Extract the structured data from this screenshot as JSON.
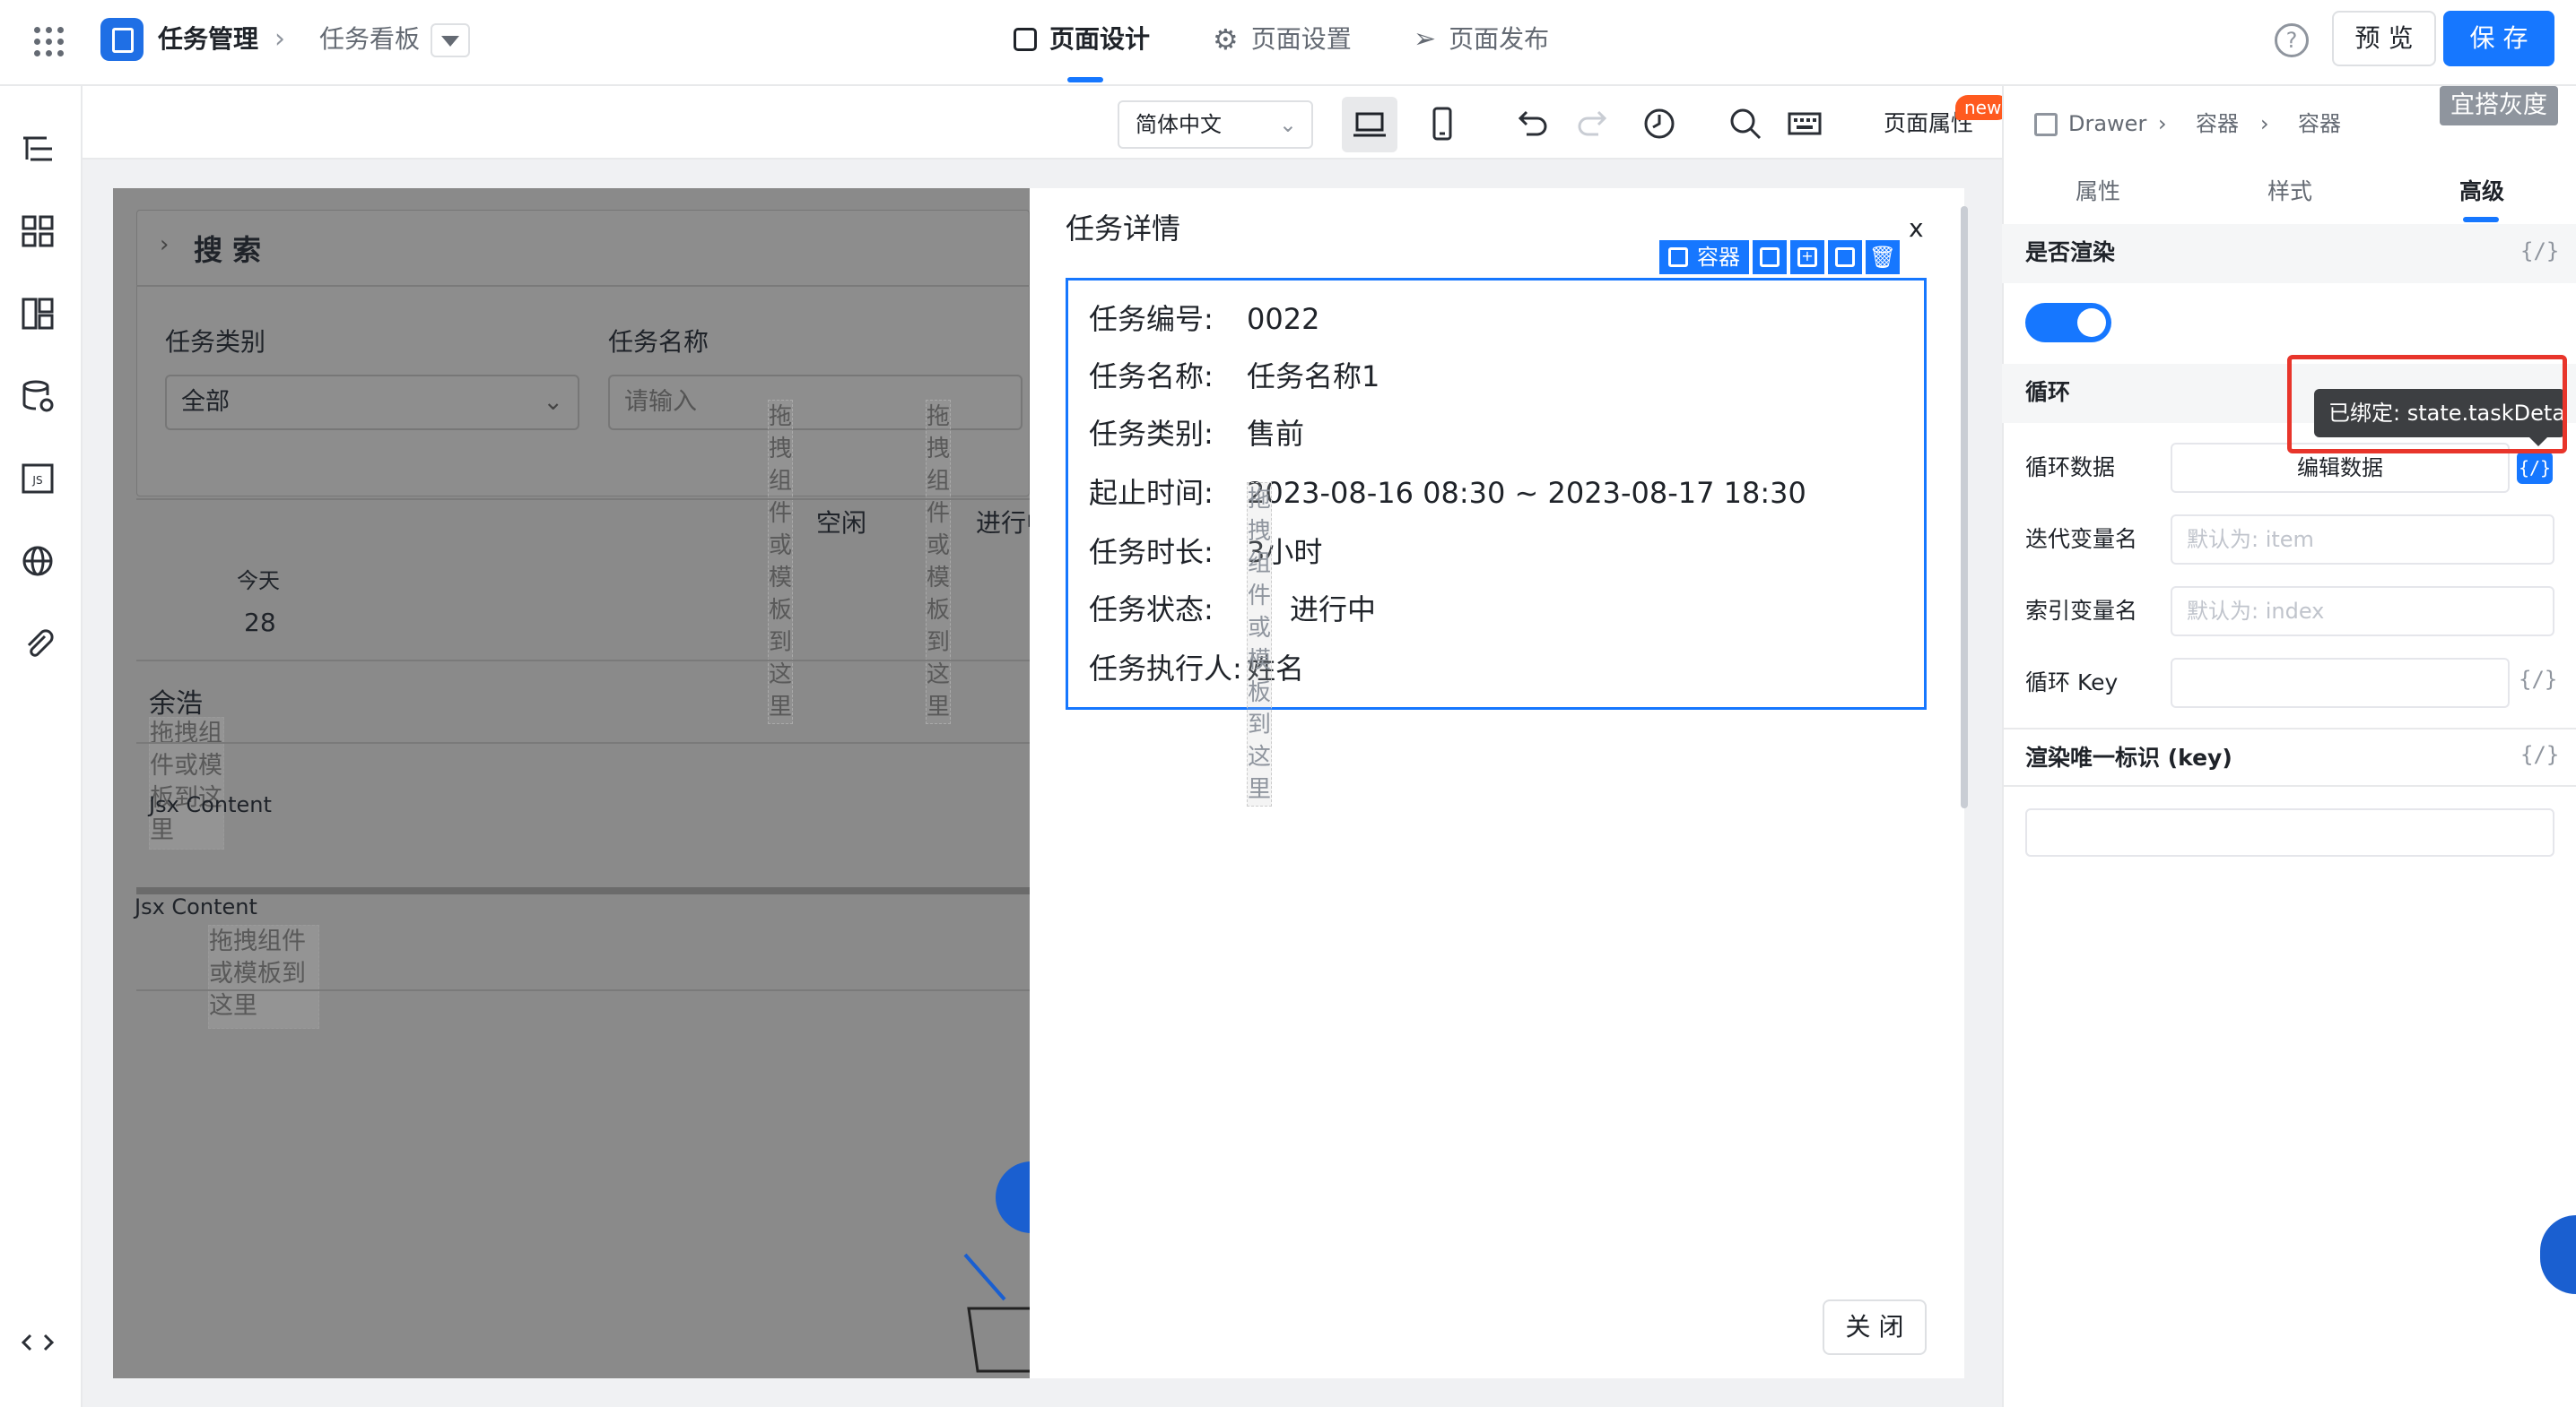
{
  "header": {
    "breadcrumb_app": "任务管理",
    "breadcrumb_page": "任务看板",
    "tabs": [
      "页面设计",
      "页面设置",
      "页面发布"
    ],
    "preview_label": "预 览",
    "save_label": "保 存",
    "gray_badge": "宜搭灰度"
  },
  "toolbar": {
    "language": "简体中文",
    "page_props_label": "页面属性",
    "new_badge": "new"
  },
  "canvas": {
    "search_title": "搜 索",
    "filter_type_label": "任务类别",
    "filter_type_value": "全部",
    "filter_name_label": "任务名称",
    "filter_name_placeholder": "请输入",
    "status_idle": "空闲",
    "status_progress": "进行中",
    "today_label": "今天",
    "today_date": "28",
    "person_name": "余浩",
    "jsx_content_1": "Jsx Content",
    "jsx_content_2": "Jsx Content",
    "drop_hint": "拖拽组件或模板到这里",
    "drop_hint_short": "拖拽组件或模板到这里"
  },
  "drawer": {
    "title": "任务详情",
    "close_x": "x",
    "selection_label": "容器",
    "rows": [
      {
        "label": "任务编号:",
        "value": "0022"
      },
      {
        "label": "任务名称:",
        "value": "任务名称1"
      },
      {
        "label": "任务类别:",
        "value": "售前"
      },
      {
        "label": "起止时间:",
        "value": "2023-08-16 08:30 ~ 2023-08-17 18:30"
      },
      {
        "label": "任务时长:",
        "value": "3小时"
      },
      {
        "label": "任务状态:",
        "value": "进行中"
      },
      {
        "label": "任务执行人:",
        "value": "姓名"
      }
    ],
    "close_button": "关 闭"
  },
  "right_panel": {
    "breadcrumb": [
      "Drawer",
      "容器",
      "容器"
    ],
    "tabs": [
      "属性",
      "样式",
      "高级"
    ],
    "active_tab": "高级",
    "render_section": "是否渲染",
    "render_enabled": true,
    "loop_section": "循环",
    "loop_data_label": "循环数据",
    "loop_data_button": "编辑数据",
    "iter_var_label": "迭代变量名",
    "iter_var_placeholder": "默认为: item",
    "index_var_label": "索引变量名",
    "index_var_placeholder": "默认为: index",
    "loop_key_label": "循环 Key",
    "key_section": "渲染唯一标识 (key)",
    "bind_glyph": "{/}",
    "tooltip": "已绑定: state.taskDetail"
  },
  "colors": {
    "primary": "#1677ff",
    "highlight": "#e8352b",
    "new_badge": "#ff5a1f"
  }
}
